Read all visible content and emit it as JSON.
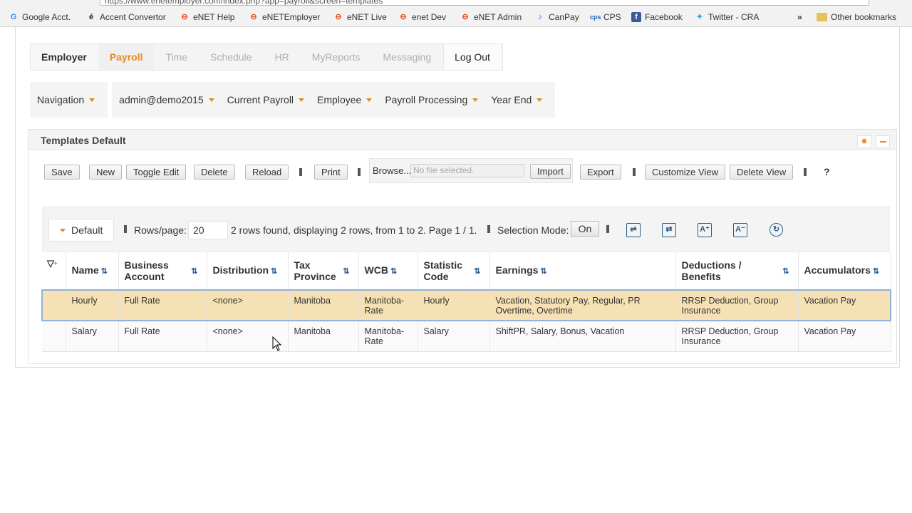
{
  "browser": {
    "address": "https://www.enetemployer.com/index.php?app=payroll&screen=templates",
    "bookmarks": [
      {
        "label": "Google Acct.",
        "icon": "google-icon"
      },
      {
        "label": "Accent Convertor",
        "icon": "accent-icon"
      },
      {
        "label": "eNET Help",
        "icon": "enet-icon"
      },
      {
        "label": "eNETEmployer",
        "icon": "enet-icon"
      },
      {
        "label": "eNET Live",
        "icon": "enet-icon"
      },
      {
        "label": "enet Dev",
        "icon": "enet-icon"
      },
      {
        "label": "eNET Admin",
        "icon": "enet-icon"
      },
      {
        "label": "CanPay",
        "icon": "canpay-icon"
      },
      {
        "label": "CPS",
        "icon": "cps-icon"
      },
      {
        "label": "Facebook",
        "icon": "facebook-icon"
      },
      {
        "label": "Twitter - CRA",
        "icon": "twitter-icon"
      }
    ],
    "more": "»",
    "other_bookmarks": "Other bookmarks"
  },
  "top_tabs": [
    "Employer",
    "Payroll",
    "Time",
    "Schedule",
    "HR",
    "MyReports",
    "Messaging",
    "Log Out"
  ],
  "subnav": {
    "navigation": "Navigation",
    "items": [
      "admin@demo2015",
      "Current Payroll",
      "Employee",
      "Payroll Processing",
      "Year End"
    ]
  },
  "panel": {
    "title": "Templates Default"
  },
  "toolbar": {
    "save": "Save",
    "new": "New",
    "toggle_edit": "Toggle Edit",
    "delete": "Delete",
    "reload": "Reload",
    "print": "Print",
    "browse": "Browse...",
    "file_placeholder": "No file selected.",
    "import": "Import",
    "export": "Export",
    "customize_view": "Customize View",
    "delete_view": "Delete View",
    "help": "?"
  },
  "grid_bar": {
    "view": "Default",
    "rows_label": "Rows/page:",
    "rows_value": "20",
    "status": "2 rows found, displaying 2 rows, from 1 to 2. Page 1 / 1.",
    "selection_label": "Selection Mode:",
    "selection_value": "On",
    "icons": [
      "wrap-rows-icon",
      "expand-columns-icon",
      "font-increase-icon",
      "font-decrease-icon",
      "reset-icon"
    ]
  },
  "table": {
    "headers": [
      "Name",
      "Business Account",
      "Distribution",
      "Tax Province",
      "WCB",
      "Statistic Code",
      "Earnings",
      "Deductions / Benefits",
      "Accumulators"
    ],
    "rows": [
      [
        "Hourly",
        "Full Rate",
        "<none>",
        "Manitoba",
        "Manitoba-Rate",
        "Hourly",
        "Vacation, Statutory Pay, Regular, PR Overtime, Overtime",
        "RRSP Deduction, Group Insurance",
        "Vacation Pay"
      ],
      [
        "Salary",
        "Full Rate",
        "<none>",
        "Manitoba",
        "Manitoba-Rate",
        "Salary",
        "ShiftPR, Salary, Bonus, Vacation",
        "RRSP Deduction, Group Insurance",
        "Vacation Pay"
      ]
    ]
  },
  "colors": {
    "accent": "#e8881d",
    "selected_row": "#f5e1b4",
    "icon_blue": "#2b5a8c"
  }
}
